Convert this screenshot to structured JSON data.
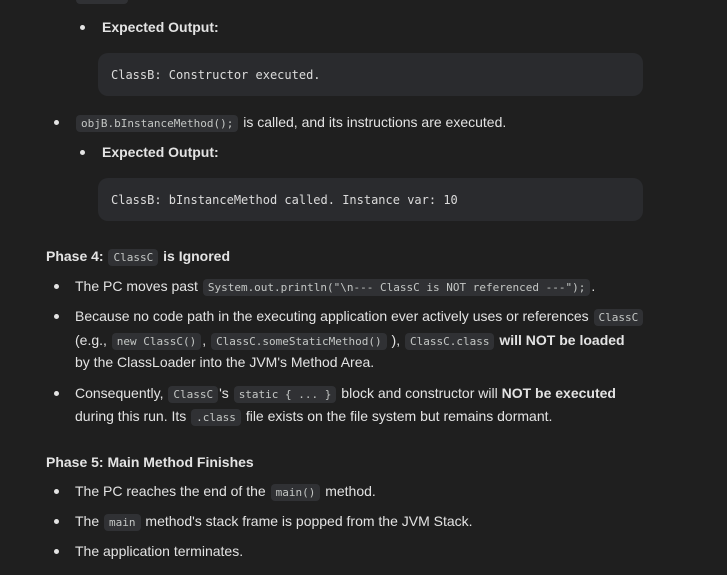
{
  "section_b": {
    "expected_label_1": "Expected Output:",
    "code_1": "ClassB: Constructor executed.",
    "method_code": "objB.bInstanceMethod();",
    "method_text": "is called, and its instructions are executed.",
    "expected_label_2": "Expected Output:",
    "code_2": "ClassB: bInstanceMethod called. Instance var: 10"
  },
  "phase4": {
    "prefix": "Phase 4:",
    "class_code": "ClassC",
    "suffix": "is Ignored",
    "b1": {
      "t1": "The PC moves past",
      "code": "System.out.println(\"\\n--- ClassC is NOT referenced ---\");",
      "t2": "."
    },
    "b2": {
      "t1": "Because no code path in the executing application ever actively uses or references",
      "code1": "ClassC",
      "t2": "(e.g.,",
      "code2": "new ClassC()",
      "t3": ",",
      "code3": "ClassC.someStaticMethod()",
      "t4": "),",
      "code4": "ClassC.class",
      "bold": "will NOT be loaded",
      "t5": "by the ClassLoader into the JVM's Method Area."
    },
    "b3": {
      "t1": "Consequently,",
      "code1": "ClassC",
      "t2": "'s",
      "code2": "static { ... }",
      "t3": "block and constructor will",
      "bold": "NOT be executed",
      "t4": "during this run. Its",
      "code3": ".class",
      "t5": "file exists on the file system but remains dormant."
    }
  },
  "phase5": {
    "heading": "Phase 5: Main Method Finishes",
    "b1": {
      "t1": "The PC reaches the end of the",
      "code": "main()",
      "t2": "method."
    },
    "b2": {
      "t1": "The",
      "code": "main",
      "t2": "method's stack frame is popped from the JVM Stack."
    },
    "b3": {
      "t1": "The application terminates."
    }
  }
}
